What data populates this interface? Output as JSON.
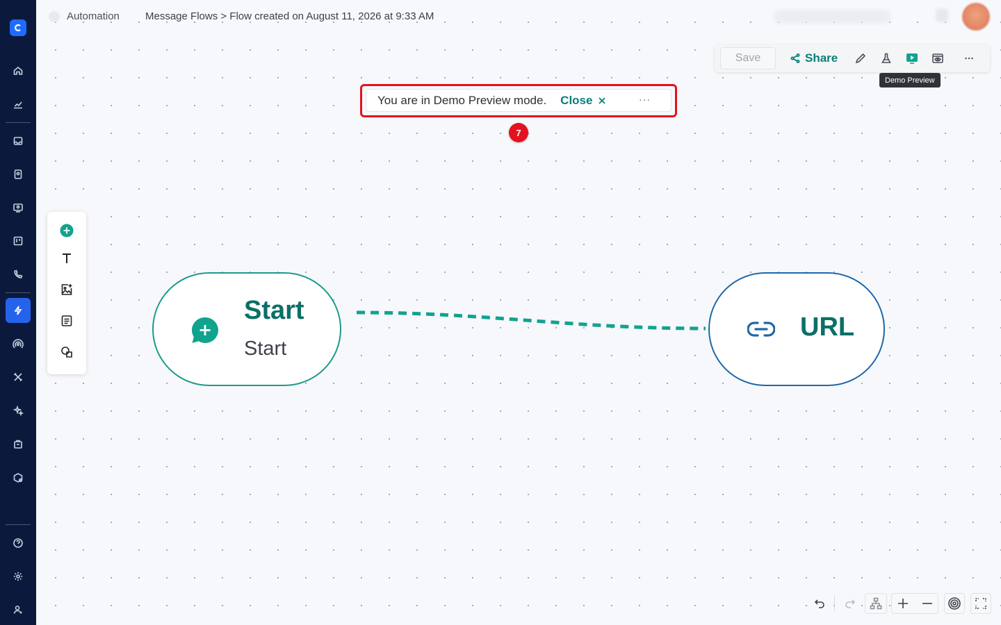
{
  "breadcrumb": {
    "section": "Automation",
    "path": "Message Flows > Flow created on August 11, 2026 at 9:33 AM"
  },
  "toolbar": {
    "save_label": "Save",
    "share_label": "Share",
    "tooltip": "Demo Preview"
  },
  "banner": {
    "text": "You are in Demo Preview mode.",
    "close_label": "Close",
    "more": "···",
    "badge": "7"
  },
  "nodes": {
    "start": {
      "title": "Start",
      "subtitle": "Start"
    },
    "url": {
      "title": "URL"
    }
  },
  "colors": {
    "accent": "#0a7f78",
    "sidebar": "#0b1a3c",
    "active_nav": "#2563eb",
    "highlight": "#e3121e",
    "url_border": "#1e67a8",
    "start_border": "#1a9a8a"
  },
  "icons": {
    "sidebar": [
      "home-icon",
      "analytics-icon",
      "inbox-icon",
      "contacts-icon",
      "chat-icon",
      "board-icon",
      "phone-icon",
      "automation-icon",
      "broadcast-icon",
      "tools-icon",
      "ai-icon",
      "commerce-icon",
      "integrations-icon",
      "help-icon",
      "settings-icon",
      "user-icon"
    ],
    "palette": [
      "add-node-icon",
      "text-icon",
      "image-icon",
      "note-icon",
      "shapes-icon"
    ]
  }
}
